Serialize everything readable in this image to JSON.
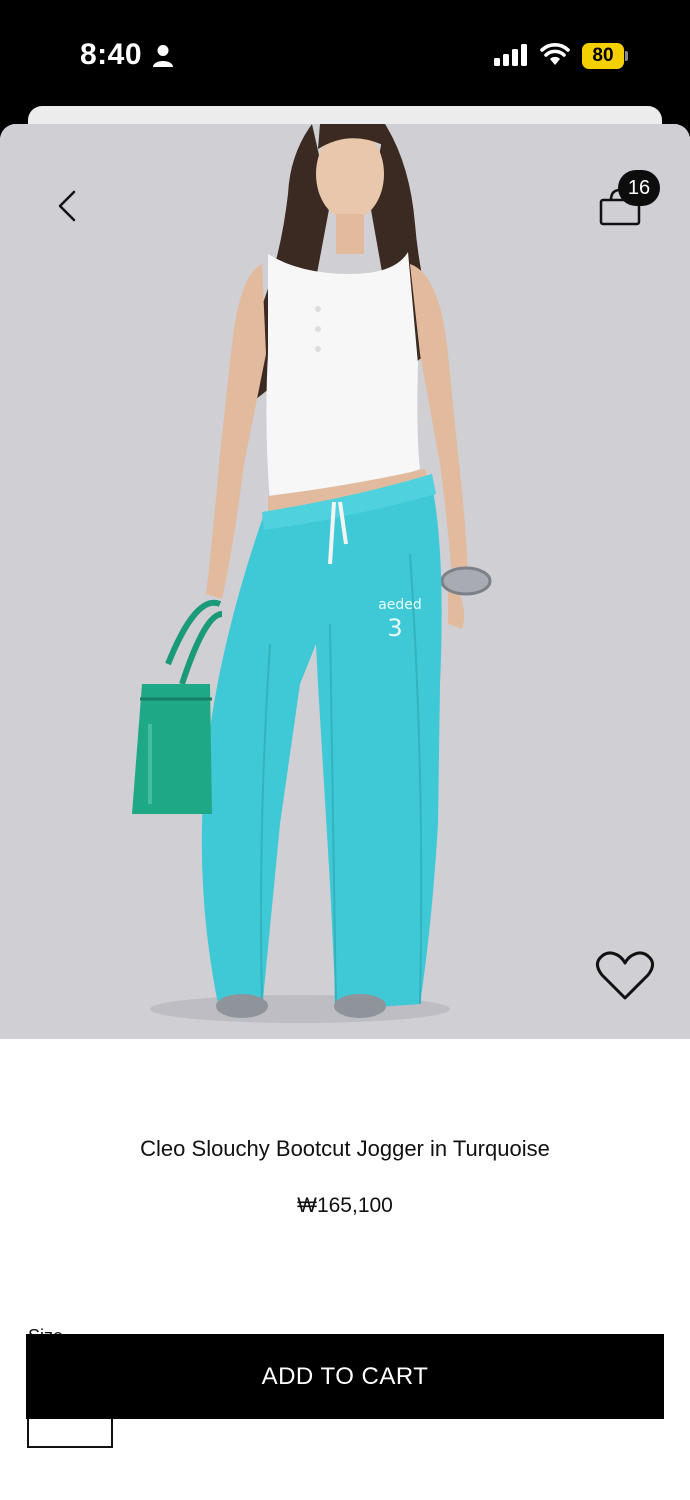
{
  "status_bar": {
    "time": "8:40",
    "battery_level": "80",
    "battery_color": "#f5d000",
    "icons": [
      "person-icon",
      "signal-icon",
      "wifi-icon",
      "battery-icon"
    ]
  },
  "header": {
    "back_icon": "chevron-left-icon",
    "bag_icon": "shopping-bag-icon",
    "bag_count": "16"
  },
  "product": {
    "image_alt": "Model wearing turquoise wide-leg jogger pants with a white tank top, holding a green handbag",
    "name": "Cleo Slouchy Bootcut Jogger in Turquoise",
    "price": "₩165,100",
    "pants_color": "#3fc9d6",
    "wishlist_icon": "heart-outline-icon"
  },
  "size": {
    "label": "Size"
  },
  "cta": {
    "add_to_cart_label": "ADD TO CART",
    "button_color": "#000000"
  }
}
